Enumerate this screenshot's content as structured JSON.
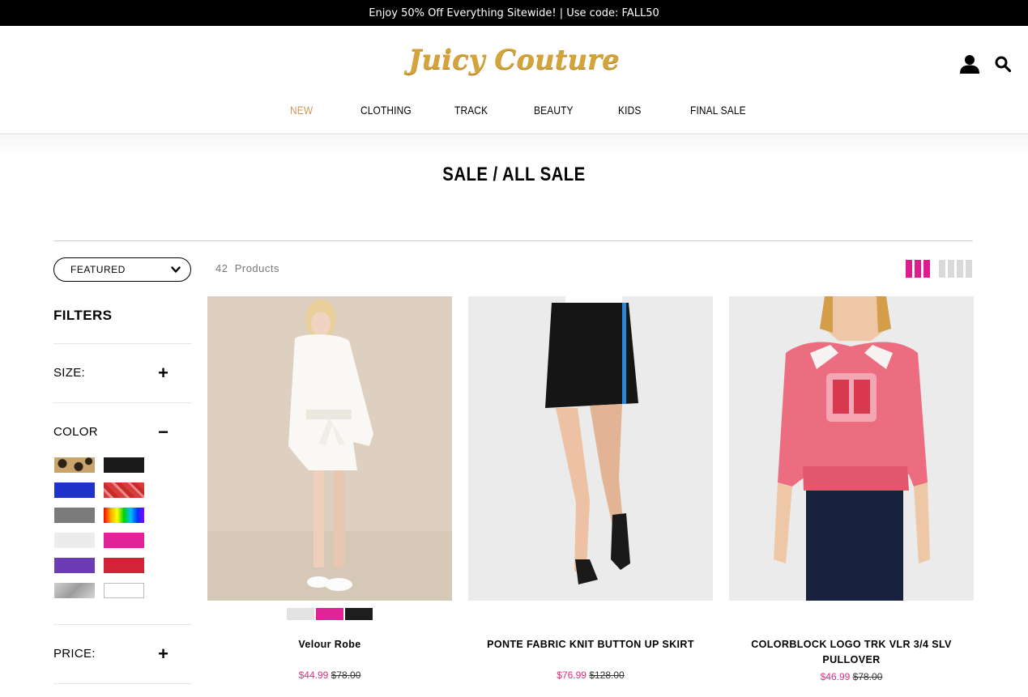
{
  "promo": {
    "text": "Enjoy 50% Off Everything Sitewide! | Use code: FALL50"
  },
  "header": {
    "logo": "Juicy Couture",
    "account_icon": "user-icon",
    "search_icon": "search-icon"
  },
  "nav": {
    "items": [
      "NEW",
      "CLOTHING",
      "TRACK",
      "BEAUTY",
      "KIDS",
      "FINAL SALE"
    ],
    "active": "NEW",
    "active_color": "#d09a52"
  },
  "page": {
    "title": "SALE / ALL SALE"
  },
  "toolbar": {
    "sort_selected": "FEATURED",
    "count_number": "42",
    "count_label": "Products",
    "grid_active_color": "#e01b8f"
  },
  "filters": {
    "heading": "FILTERS",
    "size_label": "SIZE:",
    "size_toggle": "+",
    "color_label": "COLOR",
    "color_toggle": "−",
    "price_label": "PRICE:",
    "price_toggle": "+",
    "color_swatches": [
      {
        "name": "leopard"
      },
      {
        "name": "black",
        "color": "#1a1a1a"
      },
      {
        "name": "blue",
        "color": "#1f31c9"
      },
      {
        "name": "red-print"
      },
      {
        "name": "grey",
        "color": "#7b7b7b"
      },
      {
        "name": "multi"
      },
      {
        "name": "white",
        "color": "#ececec"
      },
      {
        "name": "pink",
        "color": "#e1239a"
      },
      {
        "name": "purple",
        "color": "#6c3cb5"
      },
      {
        "name": "red",
        "color": "#d32437"
      },
      {
        "name": "silver",
        "color": "#b7b7b7"
      },
      {
        "name": "white-outline",
        "color": "#ffffff"
      }
    ]
  },
  "products": [
    {
      "name": "Velour Robe",
      "sale_price": "$44.99",
      "original_price": "$78.00",
      "swatches": [
        "#e3e3e3",
        "#e1239a",
        "#1e1e1e"
      ]
    },
    {
      "name": "PONTE FABRIC KNIT BUTTON UP SKIRT",
      "sale_price": "$76.99",
      "original_price": "$128.00"
    },
    {
      "name_line1": "COLORBLOCK LOGO TRK VLR 3/4 SLV",
      "name_line2": "PULLOVER",
      "sale_price": "$46.99",
      "original_price": "$78.00"
    }
  ]
}
